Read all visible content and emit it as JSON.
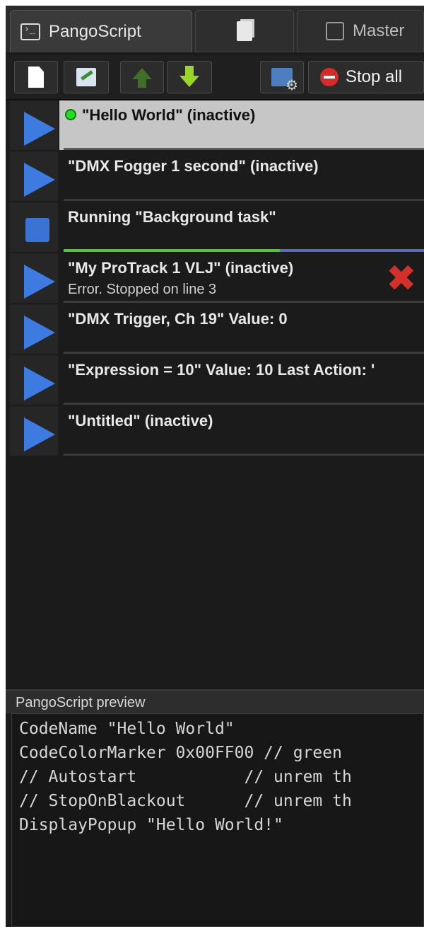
{
  "tabs": [
    {
      "label": "PangoScript",
      "icon": "terminal-icon"
    },
    {
      "label": "",
      "icon": "documents-icon"
    },
    {
      "label": "Master",
      "icon": "master-icon"
    }
  ],
  "toolbar": {
    "new_icon": "new-document-icon",
    "edit_icon": "edit-script-icon",
    "up_icon": "arrow-up-icon",
    "down_icon": "arrow-down-icon",
    "settings_icon": "settings-icon",
    "stop_all_label": "Stop all"
  },
  "scripts": [
    {
      "title": "\"Hello World\" (inactive)",
      "subtitle": "",
      "state": "play",
      "selected": true,
      "color_marker": "#22dd22"
    },
    {
      "title": "\"DMX Fogger 1 second\" (inactive)",
      "subtitle": "",
      "state": "play"
    },
    {
      "title": "Running \"Background task\"",
      "subtitle": "",
      "state": "stop",
      "progress": 0.6
    },
    {
      "title": "\"My ProTrack 1 VLJ\" (inactive)",
      "subtitle": "Error. Stopped on line 3",
      "state": "play",
      "error": true
    },
    {
      "title": "\"DMX Trigger, Ch 19\" Value: 0",
      "subtitle": "",
      "state": "play"
    },
    {
      "title": "\"Expression = 10\" Value: 10 Last Action: '",
      "subtitle": "",
      "state": "play"
    },
    {
      "title": "\"Untitled\" (inactive)",
      "subtitle": "",
      "state": "play"
    }
  ],
  "preview": {
    "header": "PangoScript preview",
    "lines": [
      "CodeName \"Hello World\"",
      "CodeColorMarker 0x00FF00 // green",
      "// Autostart           // unrem th",
      "// StopOnBlackout      // unrem th",
      "DisplayPopup \"Hello World!\""
    ]
  },
  "colors": {
    "accent_play": "#3d7be0",
    "progress_green": "#55c43a",
    "error_red": "#d2302a"
  }
}
